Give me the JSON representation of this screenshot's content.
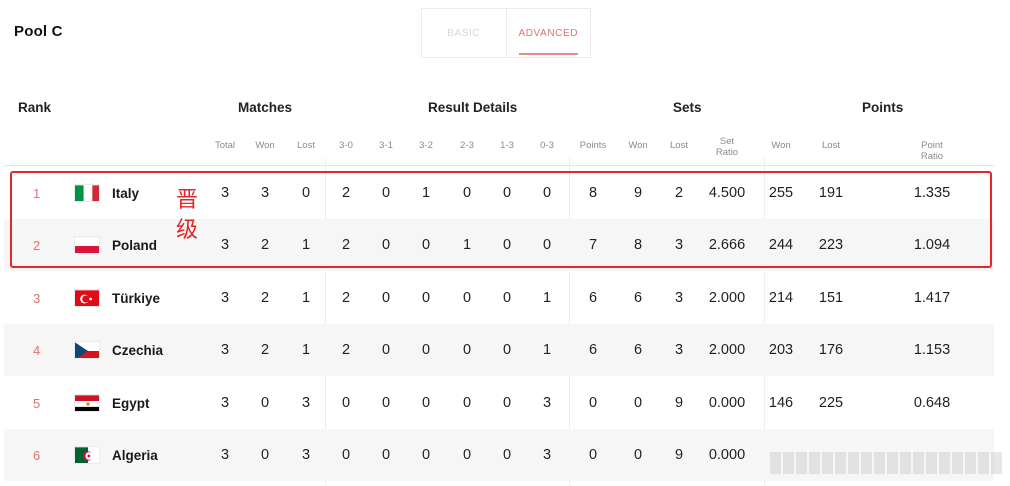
{
  "pool_title": "Pool C",
  "tabs": [
    "BASIC",
    "ADVANCED"
  ],
  "active_tab": "ADVANCED",
  "column_groups": {
    "rank": "Rank",
    "matches": "Matches",
    "result_details": "Result Details",
    "sets": "Sets",
    "points": "Points"
  },
  "columns": [
    "Total",
    "Won",
    "Lost",
    "3-0",
    "3-1",
    "3-2",
    "2-3",
    "1-3",
    "0-3",
    "Points",
    "Won",
    "Lost",
    "Set Ratio",
    "Won",
    "Lost",
    "Point Ratio"
  ],
  "annotation": [
    "晋",
    "级"
  ],
  "colors": {
    "accent": "#e0736c",
    "highlight_border": "#e8262a"
  },
  "teams": [
    {
      "rank": "1",
      "name": "Italy",
      "flag": "italy-flag-icon",
      "stats": [
        "3",
        "3",
        "0",
        "2",
        "0",
        "1",
        "0",
        "0",
        "0",
        "8",
        "9",
        "2",
        "4.500",
        "255",
        "191",
        "1.335"
      ]
    },
    {
      "rank": "2",
      "name": "Poland",
      "flag": "poland-flag-icon",
      "stats": [
        "3",
        "2",
        "1",
        "2",
        "0",
        "0",
        "1",
        "0",
        "0",
        "7",
        "8",
        "3",
        "2.666",
        "244",
        "223",
        "1.094"
      ]
    },
    {
      "rank": "3",
      "name": "Türkiye",
      "flag": "turkiye-flag-icon",
      "stats": [
        "3",
        "2",
        "1",
        "2",
        "0",
        "0",
        "0",
        "0",
        "1",
        "6",
        "6",
        "3",
        "2.000",
        "214",
        "151",
        "1.417"
      ]
    },
    {
      "rank": "4",
      "name": "Czechia",
      "flag": "czechia-flag-icon",
      "stats": [
        "3",
        "2",
        "1",
        "2",
        "0",
        "0",
        "0",
        "0",
        "1",
        "6",
        "6",
        "3",
        "2.000",
        "203",
        "176",
        "1.153"
      ]
    },
    {
      "rank": "5",
      "name": "Egypt",
      "flag": "egypt-flag-icon",
      "stats": [
        "3",
        "0",
        "3",
        "0",
        "0",
        "0",
        "0",
        "0",
        "3",
        "0",
        "0",
        "9",
        "0.000",
        "146",
        "225",
        "0.648"
      ]
    },
    {
      "rank": "6",
      "name": "Algeria",
      "flag": "algeria-flag-icon",
      "stats": [
        "3",
        "0",
        "3",
        "0",
        "0",
        "0",
        "0",
        "0",
        "3",
        "0",
        "0",
        "9",
        "0.000",
        "",
        "",
        ""
      ]
    }
  ]
}
